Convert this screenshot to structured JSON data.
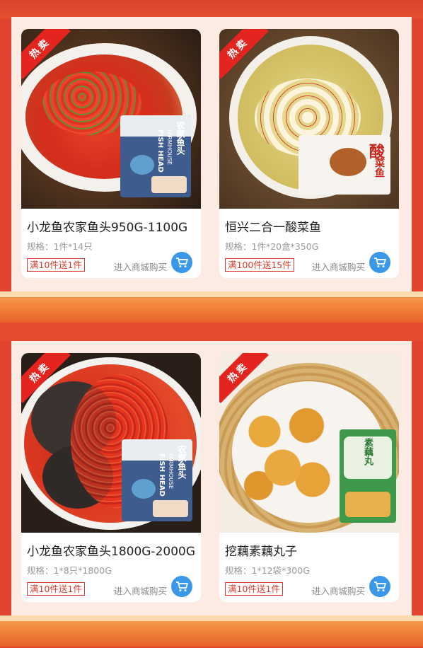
{
  "badge_label": "热卖",
  "buy_label": "进入商城购买",
  "products": [
    {
      "name": "小龙鱼农家鱼头950G-1100G",
      "spec": "规格：1件*14只",
      "promo": "满10件送1件",
      "package_text": [
        "农家鱼头",
        "FARMHOUSE",
        "FISH HEAD"
      ]
    },
    {
      "name": "恒兴二合一酸菜鱼",
      "spec": "规格：1件*20盒*350G",
      "promo": "满100件送15件",
      "package_text": [
        "酸",
        "菜鱼"
      ]
    },
    {
      "name": "小龙鱼农家鱼头1800G-2000G",
      "spec": "规格：1*8只*1800G",
      "promo": "满10件送1件",
      "package_text": [
        "农家鱼头",
        "FARMHOUSE",
        "FISH HEAD"
      ]
    },
    {
      "name": "挖藕素藕丸子",
      "spec": "规格：1*12袋*300G",
      "promo": "满10件送1件",
      "package_text": [
        "素藕丸"
      ]
    }
  ],
  "colors": {
    "background": "#e2452f",
    "panel": "#fbebe2",
    "promo": "#d73a2c",
    "cart": "#3b97e8",
    "badge": "#e3241f"
  },
  "icons": {
    "cart": "shopping-cart-icon"
  }
}
